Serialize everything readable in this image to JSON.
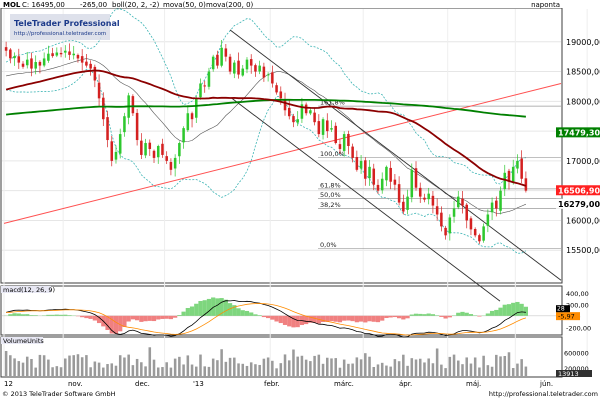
{
  "header": {
    "ticker": "MOL",
    "close_text": "C: 16495,00",
    "change_text": "-265,00",
    "indicators": [
      "boll(20, 2, -2)",
      "mova(50, 0)",
      "mova(200, 0)"
    ],
    "period": "naponta"
  },
  "watermark": {
    "brand": "TeleTrader Professional",
    "url": "http://professional.teletrader.com"
  },
  "footer": {
    "copyright": "© 2013 TeleTrader Software GmbH",
    "url": "http://professional.teletrader.com"
  },
  "colors": {
    "bull": "#2ec82e",
    "bear": "#d42020",
    "ma50": "#8b0000",
    "ma200": "#008000",
    "bollinger": "#3cb4b4",
    "trendline": "#ff5050",
    "channel": "#303030",
    "macd_line": "#000000",
    "signal_line": "#ff8c00",
    "panel_header_bg": "#2020a0",
    "label_ma200_bg": "#008000",
    "label_close_bg": "#ff2020"
  },
  "chart_data": [
    {
      "type": "candlestick",
      "panel": "price",
      "ylim": [
        15000,
        19500
      ],
      "y_ticks": [
        15500,
        16000,
        16500,
        17000,
        17500,
        18000,
        18500,
        19000
      ],
      "y_tick_labels": [
        "15500,00",
        "16000,00",
        "16500,00",
        "17000,00",
        "17500,00",
        "18000,00",
        "18500,00",
        "19000,00"
      ],
      "x_labels": [
        "12",
        "nov.",
        "dec.",
        "'13",
        "febr.",
        "márc.",
        "ápr.",
        "máj.",
        "jún."
      ],
      "last_close_label": "16506,90",
      "ma200_label": "17479,30",
      "secondary_label": "16279,00",
      "fib_levels": [
        {
          "label": "161,8%",
          "value": 17920
        },
        {
          "label": "100,0%",
          "value": 17060
        },
        {
          "label": "61,8%",
          "value": 16530
        },
        {
          "label": "50,0%",
          "value": 16370
        },
        {
          "label": "38,2%",
          "value": 16200
        },
        {
          "label": "0,0%",
          "value": 15530
        }
      ],
      "closes": [
        18850,
        18720,
        18760,
        18650,
        18580,
        18700,
        18550,
        18660,
        18600,
        18720,
        18800,
        18760,
        18820,
        18790,
        18850,
        18780,
        18800,
        18720,
        18650,
        18600,
        18550,
        18350,
        18050,
        17700,
        17350,
        17000,
        17150,
        17450,
        17750,
        18100,
        17800,
        17350,
        17100,
        17300,
        17200,
        17050,
        17250,
        17100,
        17000,
        16850,
        17050,
        17300,
        17550,
        17800,
        17700,
        18050,
        18300,
        18250,
        18500,
        18750,
        18600,
        18900,
        18750,
        18500,
        18650,
        18450,
        18550,
        18700,
        18600,
        18500,
        18600,
        18400,
        18450,
        18300,
        18150,
        18050,
        17850,
        17750,
        17650,
        17700,
        17950,
        17800,
        17850,
        17650,
        17450,
        17700,
        17500,
        17550,
        17300,
        17200,
        17450,
        17250,
        17050,
        16850,
        17000,
        16700,
        16900,
        16600,
        16500,
        16700,
        16900,
        16650,
        16600,
        16300,
        16150,
        16400,
        16850,
        16550,
        16400,
        16350,
        16450,
        16250,
        16100,
        15900,
        15750,
        16050,
        16200,
        16400,
        16250,
        16000,
        15850,
        15750,
        15650,
        15900,
        16100,
        16300,
        16200,
        16500,
        16800,
        16650,
        16900,
        17000,
        16700,
        16500
      ]
    },
    {
      "type": "line",
      "panel": "macd",
      "title": "macd(12, 26, 9)",
      "ylim": [
        -300,
        450
      ],
      "y_ticks": [
        400,
        200,
        0,
        -200
      ],
      "y_tick_labels": [
        "400,00",
        "200,00",
        "0,00",
        "-200,00"
      ],
      "last_value_label": "-5,97",
      "second_value_label": "28"
    },
    {
      "type": "bar",
      "panel": "volume",
      "title": "VolumeUnits",
      "ylim": [
        0,
        900000
      ],
      "y_ticks": [
        600000,
        200000
      ],
      "y_tick_labels": [
        "600000",
        "200000"
      ],
      "last_value_label": "13913"
    }
  ]
}
